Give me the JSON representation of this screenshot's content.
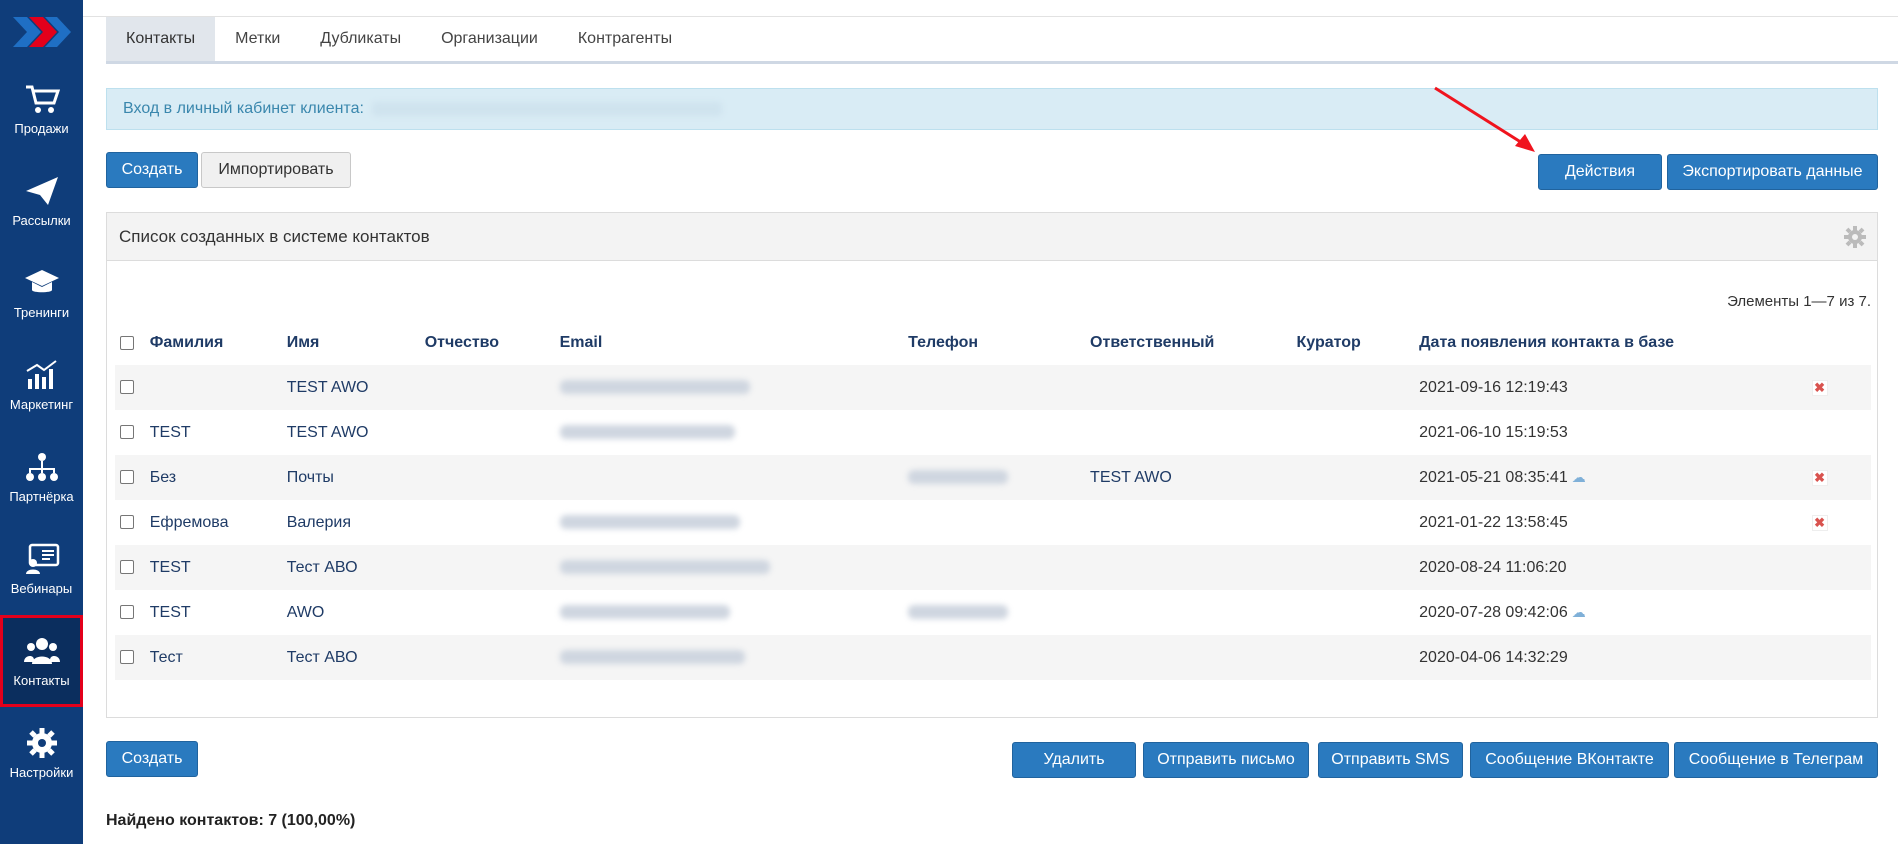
{
  "sidebar": {
    "items": [
      {
        "label": "Продажи",
        "icon": "cart-icon"
      },
      {
        "label": "Рассылки",
        "icon": "paper-plane-icon"
      },
      {
        "label": "Тренинги",
        "icon": "graduation-cap-icon"
      },
      {
        "label": "Маркетинг",
        "icon": "chart-icon"
      },
      {
        "label": "Партнёрка",
        "icon": "network-icon"
      },
      {
        "label": "Вебинары",
        "icon": "webinar-icon"
      },
      {
        "label": "Контакты",
        "icon": "users-icon",
        "active": true
      },
      {
        "label": "Настройки",
        "icon": "gear-icon"
      }
    ]
  },
  "tabs": [
    "Контакты",
    "Метки",
    "Дубликаты",
    "Организации",
    "Контрагенты"
  ],
  "alert": {
    "text": "Вход в личный кабинет клиента:"
  },
  "toolbar": {
    "create_label": "Создать",
    "import_label": "Импортировать",
    "actions_label": "Действия",
    "export_label": "Экспортировать данные"
  },
  "panel": {
    "title": "Список созданных в системе контактов",
    "summary": "Элементы 1—7 из 7."
  },
  "table": {
    "headers": [
      "Фамилия",
      "Имя",
      "Отчество",
      "Email",
      "Телефон",
      "Ответственный",
      "Куратор",
      "Дата появления контакта в базе"
    ],
    "rows": [
      {
        "lastname": "",
        "firstname": "TEST AWO",
        "middlename": "",
        "responsible": "",
        "curator": "",
        "date": "2021-09-16 12:19:43"
      },
      {
        "lastname": "TEST",
        "firstname": "TEST AWO",
        "middlename": "",
        "responsible": "",
        "curator": "",
        "date": "2021-06-10 15:19:53"
      },
      {
        "lastname": "Без",
        "firstname": "Почты",
        "middlename": "",
        "responsible": "TEST AWO",
        "curator": "",
        "date": "2021-05-21 08:35:41"
      },
      {
        "lastname": "Ефремова",
        "firstname": "Валерия",
        "middlename": "",
        "responsible": "",
        "curator": "",
        "date": "2021-01-22 13:58:45"
      },
      {
        "lastname": "TEST",
        "firstname": "Тест АВО",
        "middlename": "",
        "responsible": "",
        "curator": "",
        "date": "2020-08-24 11:06:20"
      },
      {
        "lastname": "TEST",
        "firstname": "AWO",
        "middlename": "",
        "responsible": "",
        "curator": "",
        "date": "2020-07-28 09:42:06"
      },
      {
        "lastname": "Тест",
        "firstname": "Тест АВО",
        "middlename": "",
        "responsible": "",
        "curator": "",
        "date": "2020-04-06 14:32:29"
      }
    ]
  },
  "bottom": {
    "create_label": "Создать",
    "delete_label": "Удалить",
    "send_letter_label": "Отправить письмо",
    "send_sms_label": "Отправить SMS",
    "vk_label": "Сообщение ВКонтакте",
    "telegram_label": "Сообщение в Телеграм",
    "found": "Найдено контактов: 7 (100,00%)"
  },
  "colors": {
    "sidebar": "#0f3d7a",
    "primary": "#2a7abf",
    "active_outline": "#e3001b",
    "alert_bg": "#d9ecf5"
  }
}
